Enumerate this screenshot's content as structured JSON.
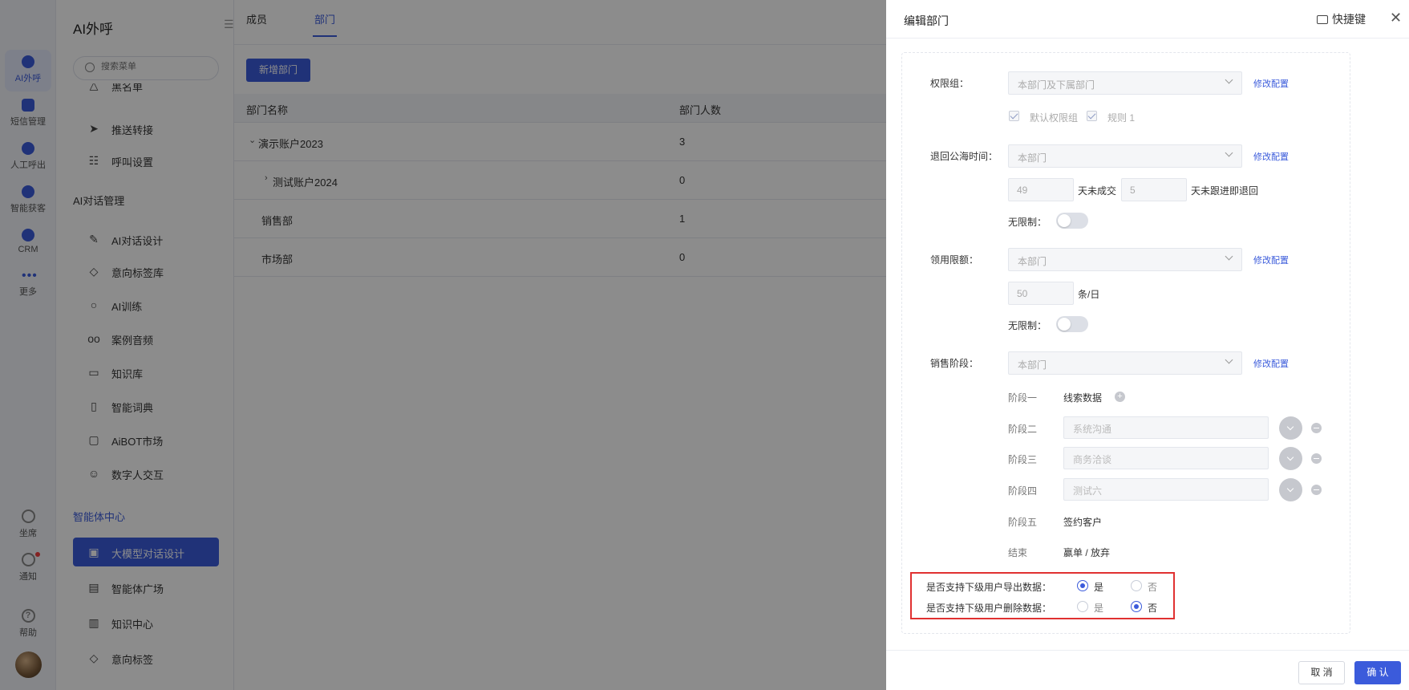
{
  "rail": {
    "items": [
      {
        "label": "AI外呼",
        "icon": "phone-robot-icon"
      },
      {
        "label": "短信管理",
        "icon": "message-icon"
      },
      {
        "label": "人工呼出",
        "icon": "call-icon"
      },
      {
        "label": "智能获客",
        "icon": "target-icon"
      },
      {
        "label": "CRM",
        "icon": "crm-icon"
      },
      {
        "label": "更多",
        "icon": "more-icon"
      }
    ],
    "bottom": [
      {
        "label": "坐席",
        "icon": "headset-icon"
      },
      {
        "label": "通知",
        "icon": "bell-icon"
      },
      {
        "label": "帮助",
        "icon": "help-icon"
      }
    ]
  },
  "sidebar": {
    "title": "AI外呼",
    "search_placeholder": "搜索菜单",
    "partial_item": "黑名单",
    "items_a": [
      {
        "label": "推送转接",
        "icon": "send-icon"
      },
      {
        "label": "呼叫设置",
        "icon": "sliders-icon"
      }
    ],
    "group_ai": "AI对话管理",
    "items_b": [
      {
        "label": "AI对话设计",
        "icon": "pen-icon"
      },
      {
        "label": "意向标签库",
        "icon": "tag-icon"
      },
      {
        "label": "AI训练",
        "icon": "chat-icon"
      },
      {
        "label": "案例音频",
        "icon": "voicemail-icon"
      },
      {
        "label": "知识库",
        "icon": "laptop-icon"
      },
      {
        "label": "智能词典",
        "icon": "book-icon"
      },
      {
        "label": "AiBOT市场",
        "icon": "bot-market-icon"
      },
      {
        "label": "数字人交互",
        "icon": "digital-human-icon"
      }
    ],
    "group_agent": "智能体中心",
    "items_c": [
      {
        "label": "大模型对话设计",
        "icon": "model-chat-icon"
      },
      {
        "label": "智能体广场",
        "icon": "store-icon"
      },
      {
        "label": "知识中心",
        "icon": "book-open-icon"
      },
      {
        "label": "意向标签",
        "icon": "tag-icon"
      }
    ]
  },
  "main": {
    "tabs": [
      "成员",
      "部门"
    ],
    "add_button": "新增部门",
    "columns": [
      "部门名称",
      "部门人数"
    ],
    "rows": [
      {
        "name": "演示账户2023",
        "count": "3"
      },
      {
        "name": "测试账户2024",
        "count": "0"
      },
      {
        "name": "销售部",
        "count": "1"
      },
      {
        "name": "市场部",
        "count": "0"
      }
    ]
  },
  "drawer": {
    "title": "编辑部门",
    "shortcut": "快捷键",
    "perm_group": {
      "label": "权限组：",
      "select": "本部门及下属部门",
      "link": "修改配置",
      "checkboxes": [
        "默认权限组",
        "规则 1"
      ]
    },
    "return_time": {
      "label": "退回公海时间：",
      "select": "本部门",
      "link": "修改配置",
      "days_a": "49",
      "text_a": "天未成交",
      "days_b": "5",
      "text_b": "天未跟进即退回",
      "unlimited": "无限制："
    },
    "quota": {
      "label": "领用限额：",
      "select": "本部门",
      "link": "修改配置",
      "amount": "50",
      "unit": "条/日",
      "unlimited": "无限制："
    },
    "stage": {
      "label": "销售阶段：",
      "select": "本部门",
      "link": "修改配置",
      "stages": [
        {
          "name": "阶段一",
          "value": "线索数据"
        },
        {
          "name": "阶段二",
          "value": "系统沟通"
        },
        {
          "name": "阶段三",
          "value": "商务洽谈"
        },
        {
          "name": "阶段四",
          "value": "测试六"
        },
        {
          "name": "阶段五",
          "value": "签约客户"
        },
        {
          "name": "结束",
          "value": "赢单 / 放弃"
        }
      ]
    },
    "export_question": "是否支持下级用户导出数据：",
    "delete_question": "是否支持下级用户删除数据：",
    "yes": "是",
    "no": "否",
    "export_value": "是",
    "delete_value": "否",
    "cancel": "取 消",
    "confirm": "确 认"
  },
  "colors": {
    "accent": "#3b5bdb",
    "highlight": "#e03131"
  }
}
